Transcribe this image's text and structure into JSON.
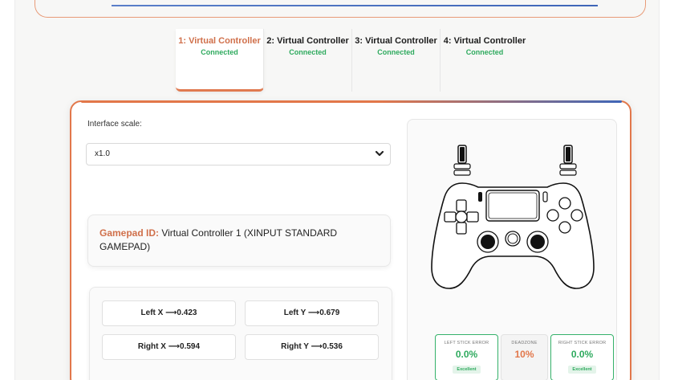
{
  "tabs": [
    {
      "title": "1: Virtual Controller",
      "status": "Connected",
      "active": true
    },
    {
      "title": "2: Virtual Controller",
      "status": "Connected",
      "active": false
    },
    {
      "title": "3: Virtual Controller",
      "status": "Connected",
      "active": false
    },
    {
      "title": "4: Virtual Controller",
      "status": "Connected",
      "active": false
    }
  ],
  "settings": {
    "scale_label": "Interface scale:",
    "scale_value": "x1.0"
  },
  "gamepad": {
    "id_label": "Gamepad ID:",
    "id_value": " Virtual Controller 1 (XINPUT STANDARD GAMEPAD)"
  },
  "axes": {
    "left_x": "Left X ⟶0.423",
    "left_y": "Left Y ⟶0.679",
    "right_x": "Right X ⟶0.594",
    "right_y": "Right Y ⟶0.536"
  },
  "stats": {
    "left_stick": {
      "caption": "LEFT STICK ERROR",
      "value": "0.0%",
      "badge": "Excellent"
    },
    "deadzone": {
      "caption": "DEADZONE",
      "value": "10%"
    },
    "right_stick": {
      "caption": "RIGHT STICK ERROR",
      "value": "0.0%",
      "badge": "Excellent"
    }
  },
  "colors": {
    "accent": "#e2774a",
    "success": "#2eaa5e",
    "blue": "#3f66b8"
  },
  "icons": {
    "select_chevron": "chevron-down-icon",
    "controller": "gamepad-icon"
  }
}
